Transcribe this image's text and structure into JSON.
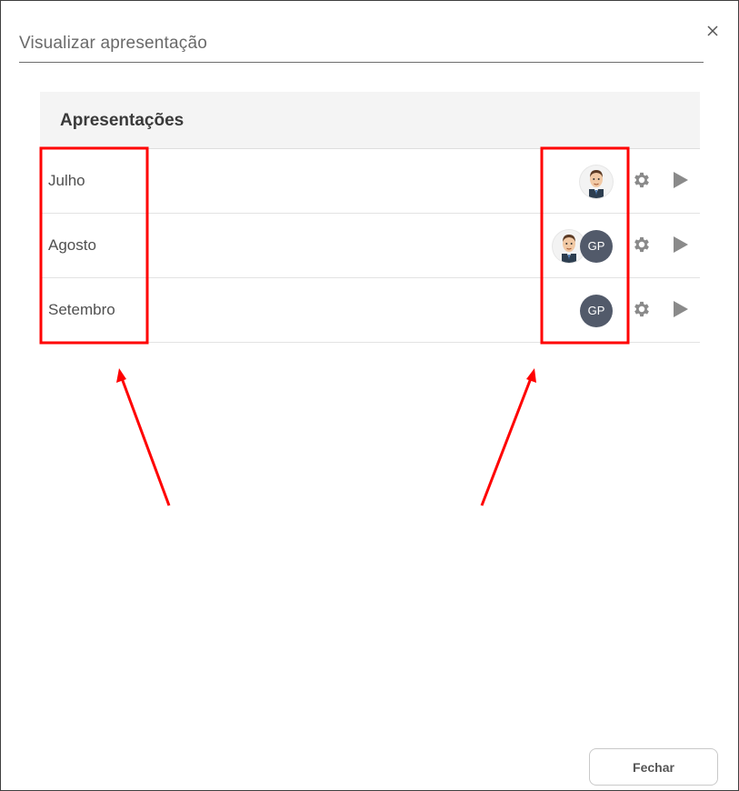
{
  "dialog": {
    "title": "Visualizar apresentação",
    "close_icon": "close-icon"
  },
  "panel": {
    "header": "Apresentações",
    "rows": [
      {
        "name": "Julho",
        "owners": [
          {
            "type": "photo",
            "icon": "user-photo-avatar"
          }
        ]
      },
      {
        "name": "Agosto",
        "owners": [
          {
            "type": "photo",
            "icon": "user-photo-avatar"
          },
          {
            "type": "initials",
            "text": "GP"
          }
        ]
      },
      {
        "name": "Setembro",
        "owners": [
          {
            "type": "initials",
            "text": "GP"
          }
        ]
      }
    ],
    "row_actions": {
      "settings_icon": "gear-icon",
      "play_icon": "play-icon"
    }
  },
  "footer": {
    "close_label": "Fechar"
  },
  "colors": {
    "annotation": "#ff0000",
    "avatar_initials_bg": "#525a6a",
    "header_bg": "#f4f4f4",
    "icon_gray": "#8a8a8a"
  }
}
